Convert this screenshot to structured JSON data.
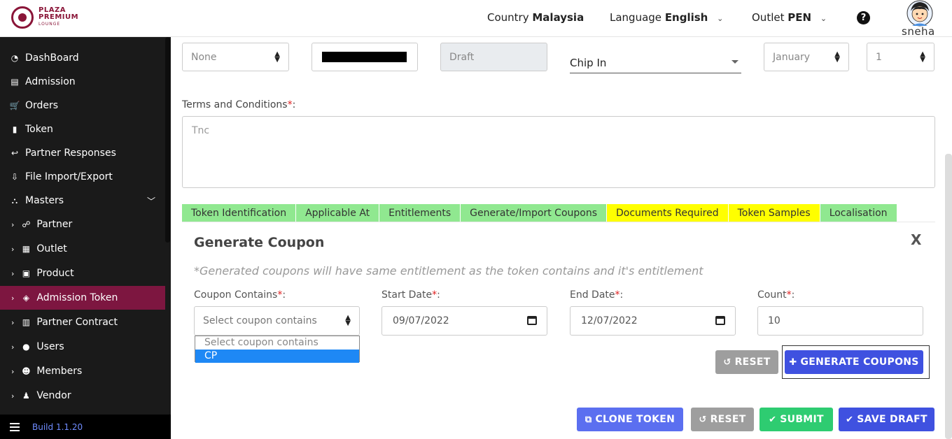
{
  "header": {
    "logo_line1": "PLAZA",
    "logo_line2": "PREMIUM",
    "logo_line3": "LOUNGE",
    "country_label": "Country",
    "country_value": "Malaysia",
    "language_label": "Language",
    "language_value": "English",
    "outlet_label": "Outlet",
    "outlet_value": "PEN",
    "help_glyph": "?",
    "user_name": "sneha"
  },
  "sidebar": {
    "items": [
      {
        "label": "DashBoard",
        "icon": "dashboard-icon",
        "glyph": "◔"
      },
      {
        "label": "Admission",
        "icon": "id-card-icon",
        "glyph": "▤"
      },
      {
        "label": "Orders",
        "icon": "cart-icon",
        "glyph": "🛒"
      },
      {
        "label": "Token",
        "icon": "file-icon",
        "glyph": "▮"
      },
      {
        "label": "Partner Responses",
        "icon": "reply-all-icon",
        "glyph": "↩"
      },
      {
        "label": "File Import/Export",
        "icon": "download-icon",
        "glyph": "⇩"
      },
      {
        "label": "Masters",
        "icon": "sitemap-icon",
        "glyph": "⛬"
      },
      {
        "label": "Partner",
        "icon": "handshake-icon",
        "glyph": "☍"
      },
      {
        "label": "Outlet",
        "icon": "building-icon",
        "glyph": "▦"
      },
      {
        "label": "Product",
        "icon": "gift-icon",
        "glyph": "▣"
      },
      {
        "label": "Admission Token",
        "icon": "ticket-icon",
        "glyph": "◈"
      },
      {
        "label": "Partner Contract",
        "icon": "briefcase-icon",
        "glyph": "▥"
      },
      {
        "label": "Users",
        "icon": "user-icon",
        "glyph": "●"
      },
      {
        "label": "Members",
        "icon": "users-icon",
        "glyph": "☻"
      },
      {
        "label": "Vendor",
        "icon": "male-icon",
        "glyph": "♟"
      }
    ],
    "build": "Build 1.1.20"
  },
  "form": {
    "select_none": "None",
    "status_value": "Draft",
    "chip_in": "Chip In",
    "month_value": "January",
    "day_value": "1",
    "tnc_label": "Terms and Conditions",
    "tnc_placeholder": "Tnc",
    "required_mark": "*",
    "colon": ":"
  },
  "tabs": [
    {
      "label": "Token Identification",
      "color": "#90e890"
    },
    {
      "label": "Applicable At",
      "color": "#90e890"
    },
    {
      "label": "Entitlements",
      "color": "#90e890"
    },
    {
      "label": "Generate/Import Coupons",
      "color": "#90e890"
    },
    {
      "label": "Documents Required",
      "color": "#ffff00"
    },
    {
      "label": "Token Samples",
      "color": "#ffff00"
    },
    {
      "label": "Localisation",
      "color": "#90e890"
    }
  ],
  "generate": {
    "title": "Generate Coupon",
    "close": "X",
    "note": "*Generated coupons will have same entitlement as the token contains and it's entitlement",
    "coupon_contains_label": "Coupon Contains",
    "coupon_contains_placeholder": "Select coupon contains",
    "start_date_label": "Start Date",
    "start_date_value": "09/07/2022",
    "end_date_label": "End Date",
    "end_date_value": "12/07/2022",
    "count_label": "Count",
    "count_value": "10",
    "options": [
      "Select coupon contains",
      "CP"
    ],
    "reset_label": "RESET",
    "generate_label": "GENERATE COUPONS"
  },
  "footer_buttons": {
    "clone": "CLONE TOKEN",
    "reset": "RESET",
    "submit": "SUBMIT",
    "save_draft": "SAVE DRAFT"
  },
  "colors": {
    "brand": "#8a1538",
    "active_sidebar": "#7d1640",
    "primary_blue": "#3f51e0",
    "submit_green": "#2ecc71"
  }
}
